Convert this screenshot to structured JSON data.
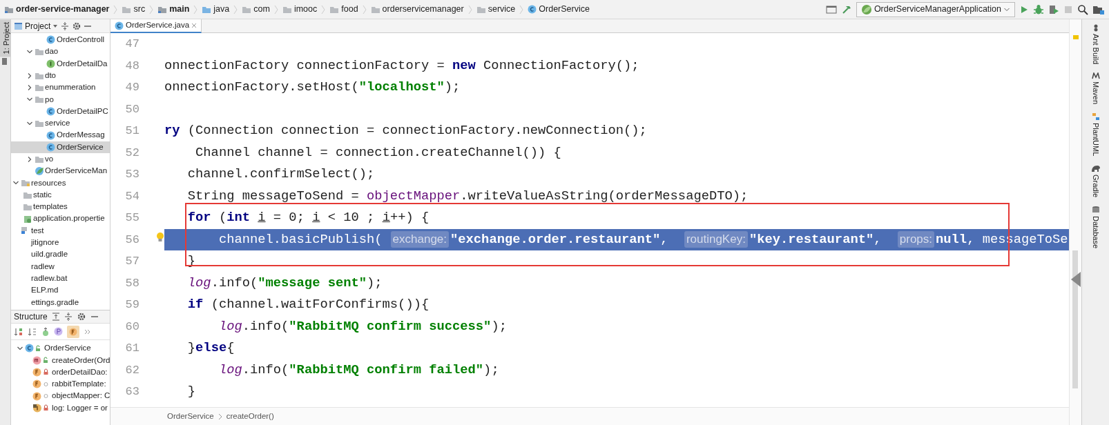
{
  "breadcrumbs": [
    {
      "label": "order-service-manager",
      "kind": "module"
    },
    {
      "label": "src",
      "kind": "folder"
    },
    {
      "label": "main",
      "kind": "module"
    },
    {
      "label": "java",
      "kind": "source"
    },
    {
      "label": "com",
      "kind": "package"
    },
    {
      "label": "imooc",
      "kind": "package"
    },
    {
      "label": "food",
      "kind": "package"
    },
    {
      "label": "orderservicemanager",
      "kind": "package"
    },
    {
      "label": "service",
      "kind": "package"
    },
    {
      "label": "OrderService",
      "kind": "class"
    }
  ],
  "run_config": {
    "label": "OrderServiceManagerApplication"
  },
  "left_strip": {
    "label": "1: Project"
  },
  "project_panel": {
    "title": "Project"
  },
  "project_tree": [
    {
      "children": [
        {
          "children": [
            {
              "children": [
                {
                  "children": [
                    {
                      "label": "OrderControll",
                      "kind": "class"
                    }
                  ]
                },
                {
                  "label": "dao",
                  "kind": "folder",
                  "expanded": true,
                  "children": [
                    {
                      "label": "OrderDetailDa",
                      "kind": "interface"
                    }
                  ]
                },
                {
                  "label": "dto",
                  "kind": "folder",
                  "expanded": false
                },
                {
                  "label": "enummeration",
                  "kind": "folder",
                  "expanded": false
                },
                {
                  "label": "po",
                  "kind": "folder",
                  "expanded": true,
                  "children": [
                    {
                      "label": "OrderDetailPC",
                      "kind": "class"
                    }
                  ]
                },
                {
                  "label": "service",
                  "kind": "folder",
                  "expanded": true,
                  "children": [
                    {
                      "label": "OrderMessag",
                      "kind": "class",
                      "selected": false
                    },
                    {
                      "label": "OrderService",
                      "kind": "class",
                      "selected": true
                    }
                  ]
                },
                {
                  "label": "vo",
                  "kind": "folder",
                  "expanded": false
                },
                {
                  "label": "OrderServiceMan",
                  "kind": "app"
                }
              ]
            }
          ]
        },
        {
          "label": "resources",
          "kind": "resources",
          "expanded": true,
          "children": [
            {
              "label": "static",
              "kind": "folder"
            },
            {
              "label": "templates",
              "kind": "folder"
            },
            {
              "label": "application.propertie",
              "kind": "properties"
            }
          ]
        }
      ]
    },
    {
      "label": "test",
      "kind": "test"
    },
    {
      "label": "jitignore",
      "kind": "file"
    },
    {
      "label": "uild.gradle",
      "kind": "file"
    },
    {
      "label": "radlew",
      "kind": "file"
    },
    {
      "label": "radlew.bat",
      "kind": "file"
    },
    {
      "label": "ELP.md",
      "kind": "file"
    },
    {
      "label": "ettings.gradle",
      "kind": "file"
    }
  ],
  "structure_panel": {
    "title": "Structure"
  },
  "structure_tree": [
    {
      "label": "OrderService",
      "kind": "public-class",
      "expanded": true,
      "children": [
        {
          "label": "createOrder(Ord",
          "kind": "public-method"
        },
        {
          "label": "orderDetailDao:",
          "kind": "private-field"
        },
        {
          "label": "rabbitTemplate:",
          "kind": "package-field"
        },
        {
          "label": "objectMapper: C",
          "kind": "package-field"
        },
        {
          "label": "log: Logger = or",
          "kind": "private-static-field"
        }
      ]
    }
  ],
  "editor_tab": {
    "label": "OrderService.java",
    "selected": true
  },
  "code_lines": [
    {
      "number": "47",
      "selected": false
    },
    {
      "number": "48",
      "selected": false,
      "tokens": [
        {
          "text": "onnectionFactory connectionFactory = ",
          "kind": "plain"
        },
        {
          "text": "new",
          "kind": "keyword"
        },
        {
          "text": " ConnectionFactory();",
          "kind": "plain"
        }
      ]
    },
    {
      "number": "49",
      "selected": false,
      "tokens": [
        {
          "text": "onnectionFactory.setHost(",
          "kind": "plain"
        },
        {
          "text": "\"localhost\"",
          "kind": "string"
        },
        {
          "text": ");",
          "kind": "plain"
        }
      ]
    },
    {
      "number": "50",
      "selected": false
    },
    {
      "number": "51",
      "selected": false,
      "tokens": [
        {
          "text": "ry",
          "kind": "keyword"
        },
        {
          "text": " (Connection connection = connectionFactory.newConnection();",
          "kind": "plain"
        }
      ]
    },
    {
      "number": "52",
      "selected": false,
      "tokens": [
        {
          "text": "    Channel channel = connection.createChannel()) {",
          "kind": "plain"
        }
      ]
    },
    {
      "number": "53",
      "selected": false,
      "tokens": [
        {
          "text": "   channel.confirmSelect();",
          "kind": "plain"
        }
      ]
    },
    {
      "number": "54",
      "selected": false,
      "tokens": [
        {
          "text": "   String messageToSend = ",
          "kind": "plain"
        },
        {
          "text": "objectMapper",
          "kind": "field"
        },
        {
          "text": ".writeValueAsString(orderMessageDTO);",
          "kind": "plain"
        }
      ]
    },
    {
      "number": "55",
      "selected": false,
      "tokens": [
        {
          "text": "   for",
          "kind": "keyword"
        },
        {
          "text": " (",
          "kind": "plain"
        },
        {
          "text": "int ",
          "kind": "keyword"
        },
        {
          "text": "i",
          "kind": "var"
        },
        {
          "text": " = 0; ",
          "kind": "plain"
        },
        {
          "text": "i",
          "kind": "var"
        },
        {
          "text": " < 10 ; ",
          "kind": "plain"
        },
        {
          "text": "i",
          "kind": "var"
        },
        {
          "text": "++) {",
          "kind": "plain"
        }
      ]
    },
    {
      "number": "56",
      "selected": true,
      "bulb": true,
      "tokens": [
        {
          "text": "       channel.basicPublish(",
          "kind": "plain"
        },
        {
          "text": "exchange:",
          "kind": "hint"
        },
        {
          "text": "\"exchange.order.restaurant\"",
          "kind": "string"
        },
        {
          "text": ", ",
          "kind": "plain"
        },
        {
          "text": "routingKey:",
          "kind": "hint"
        },
        {
          "text": "\"key.restaurant\"",
          "kind": "string"
        },
        {
          "text": ", ",
          "kind": "plain"
        },
        {
          "text": "props:",
          "kind": "hint"
        },
        {
          "text": "null",
          "kind": "keyword"
        },
        {
          "text": ", messageToSe",
          "kind": "plain"
        }
      ]
    },
    {
      "number": "57",
      "selected": false,
      "tokens": [
        {
          "text": "   }",
          "kind": "plain"
        }
      ]
    },
    {
      "number": "58",
      "selected": false,
      "tokens": [
        {
          "text": "   log",
          "kind": "static"
        },
        {
          "text": ".info(",
          "kind": "plain"
        },
        {
          "text": "\"message sent\"",
          "kind": "string"
        },
        {
          "text": ");",
          "kind": "plain"
        }
      ]
    },
    {
      "number": "59",
      "selected": false,
      "tokens": [
        {
          "text": "   if",
          "kind": "keyword"
        },
        {
          "text": " (channel.waitForConfirms()){",
          "kind": "plain"
        }
      ]
    },
    {
      "number": "60",
      "selected": false,
      "tokens": [
        {
          "text": "       log",
          "kind": "static"
        },
        {
          "text": ".info(",
          "kind": "plain"
        },
        {
          "text": "\"RabbitMQ confirm success\"",
          "kind": "string"
        },
        {
          "text": ");",
          "kind": "plain"
        }
      ]
    },
    {
      "number": "61",
      "selected": false,
      "tokens": [
        {
          "text": "   }",
          "kind": "plain"
        },
        {
          "text": "else",
          "kind": "keyword"
        },
        {
          "text": "{",
          "kind": "plain"
        }
      ]
    },
    {
      "number": "62",
      "selected": false,
      "tokens": [
        {
          "text": "       log",
          "kind": "static"
        },
        {
          "text": ".info(",
          "kind": "plain"
        },
        {
          "text": "\"RabbitMQ confirm failed\"",
          "kind": "string"
        },
        {
          "text": ");",
          "kind": "plain"
        }
      ]
    },
    {
      "number": "63",
      "selected": false,
      "tokens": [
        {
          "text": "   }",
          "kind": "plain"
        }
      ]
    }
  ],
  "editor_breadcrumbs": [
    "OrderService",
    "createOrder()"
  ],
  "right_tools": [
    {
      "label": "Ant Build",
      "kind": "ant"
    },
    {
      "label": "Maven",
      "kind": "maven"
    },
    {
      "label": "PlantUML",
      "kind": "uml"
    },
    {
      "label": "Gradle",
      "kind": "gradle"
    },
    {
      "label": "Database",
      "kind": "database"
    }
  ]
}
